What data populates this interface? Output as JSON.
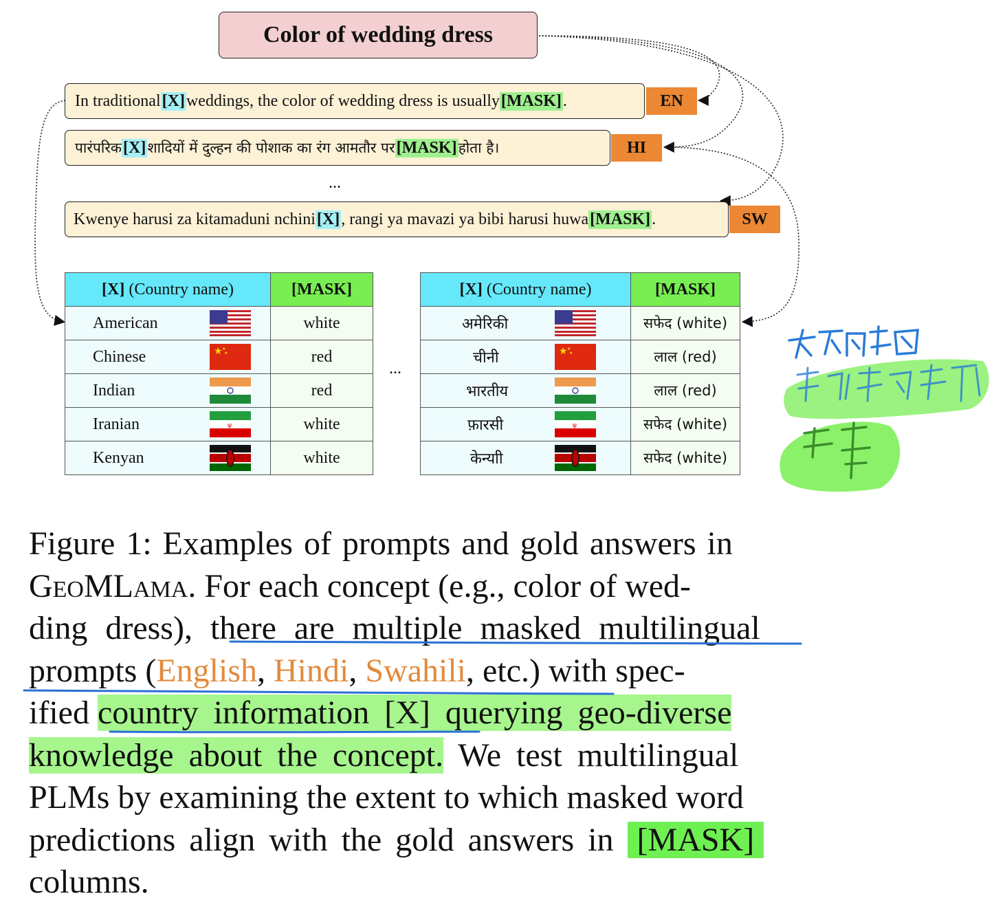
{
  "concept": {
    "title": "Color of wedding dress"
  },
  "prompts": [
    {
      "lang": "EN",
      "parts": [
        "In traditional ",
        "[X]",
        " weddings, the color of wedding dress is usually ",
        "[MASK]",
        "."
      ]
    },
    {
      "lang": "HI",
      "parts": [
        "पारंपरिक ",
        "[X]",
        " शादियों में दुल्हन की पोशाक का रंग आमतौर पर ",
        "[MASK]",
        " होता है।"
      ]
    },
    {
      "lang": "SW",
      "parts": [
        "Kwenye harusi za kitamaduni nchini ",
        "[X]",
        ", rangi ya mavazi ya bibi harusi huwa ",
        "[MASK]",
        "."
      ]
    }
  ],
  "prompt_ellipsis": "...",
  "tables": [
    {
      "header_x": "[X]",
      "header_x_rest": " (Country name)",
      "header_mask": "[MASK]",
      "rows": [
        {
          "name": "American",
          "flag": "us-flag-icon",
          "mask": "white"
        },
        {
          "name": "Chinese",
          "flag": "china-flag-icon",
          "mask": "red"
        },
        {
          "name": "Indian",
          "flag": "india-flag-icon",
          "mask": "red"
        },
        {
          "name": "Iranian",
          "flag": "iran-flag-icon",
          "mask": "white"
        },
        {
          "name": "Kenyan",
          "flag": "kenya-flag-icon",
          "mask": "white"
        }
      ]
    },
    {
      "header_x": "[X]",
      "header_x_rest": " (Country name)",
      "header_mask": "[MASK]",
      "rows": [
        {
          "name": "अमेरिकी",
          "flag": "us-flag-icon",
          "mask": "सफेद (white)"
        },
        {
          "name": "चीनी",
          "flag": "china-flag-icon",
          "mask": "लाल (red)"
        },
        {
          "name": "भारतीय",
          "flag": "india-flag-icon",
          "mask": "लाल (red)"
        },
        {
          "name": "फ़ारसी",
          "flag": "iran-flag-icon",
          "mask": "सफेद (white)"
        },
        {
          "name": "केन्याी",
          "flag": "kenya-flag-icon",
          "mask": "सफेद (white)"
        }
      ]
    }
  ],
  "table_ellipsis": "...",
  "caption": {
    "l1": "Figure 1:  Examples of prompts and gold answers in",
    "l2_geo": "GeoMLama",
    "l2_rest": ".  For each concept (e.g., color of wed-",
    "l3": "ding dress), there are multiple masked multilingual",
    "l4_a": "prompts (",
    "l4_en": "English",
    "l4_c1": ", ",
    "l4_hi": "Hindi",
    "l4_c2": ", ",
    "l4_sw": "Swahili",
    "l4_b": ", etc.)  with spec-",
    "l5_a": "ified ",
    "l5_hl": "country information [X] querying geo-diverse",
    "l6_hl": "knowledge about the concept.",
    "l6_b": " We test multilingual",
    "l7": "PLMs by examining the extent to which masked word",
    "l8_a": "predictions align with the gold answers in ",
    "l8_mask": "[MASK]",
    "l9": "columns."
  },
  "colors": {
    "x_highlight": "#a6f0f5",
    "mask_highlight": "#9ff08f",
    "lang_tag": "#ec8734",
    "title_box": "#f3cfd1",
    "prompt_box": "#fdf1d6",
    "annotation_green": "#7fef5a",
    "annotation_blue": "#2a6fd6",
    "language_orange": "#e28a3c"
  }
}
